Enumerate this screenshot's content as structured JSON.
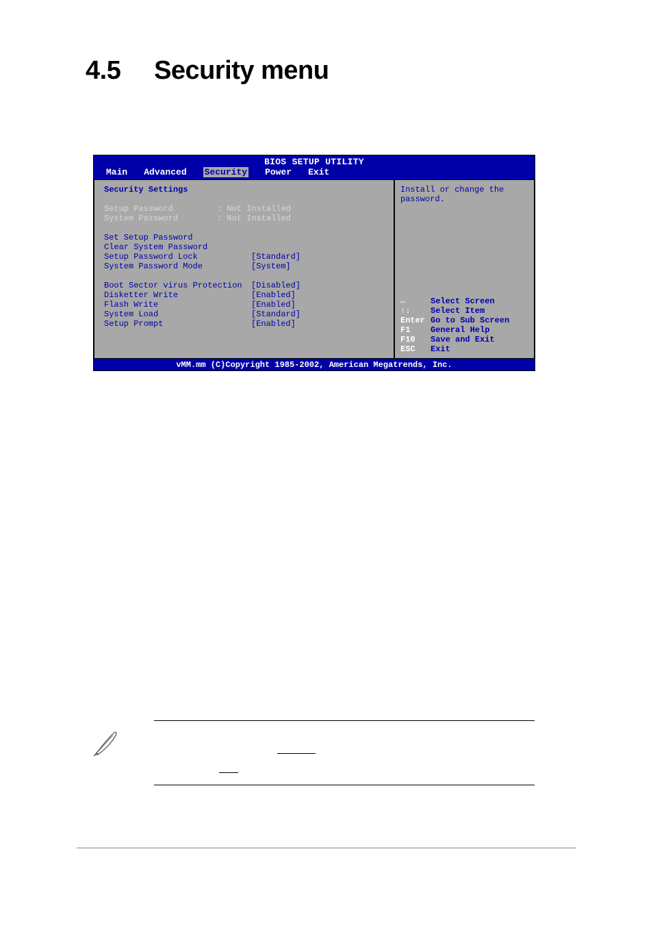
{
  "heading": {
    "num": "4.5",
    "title": "Security menu"
  },
  "bios": {
    "title": "BIOS SETUP UTILITY",
    "tabs": [
      "Main",
      "Advanced",
      "Security",
      "Power",
      "Exit"
    ],
    "selected_tab": "Security",
    "left": {
      "section_title": "Security Settings",
      "status_rows": [
        {
          "label": "Setup Password",
          "sep": ": ",
          "value": "Not Installed"
        },
        {
          "label": "System Password",
          "sep": ": ",
          "value": "Not Installed"
        }
      ],
      "action_rows": [
        {
          "label": "Set Setup Password",
          "value": ""
        },
        {
          "label": "Clear System Password",
          "value": ""
        },
        {
          "label": "Setup Password Lock",
          "value": "[Standard]"
        },
        {
          "label": "System Password Mode",
          "value": "[System]"
        }
      ],
      "option_rows": [
        {
          "label": "Boot Sector virus Protection",
          "value": "[Disabled]"
        },
        {
          "label": "Disketter Write",
          "value": "[Enabled]"
        },
        {
          "label": "Flash Write",
          "value": "[Enabled]"
        },
        {
          "label": "System Load",
          "value": "[Standard]"
        },
        {
          "label": "Setup Prompt",
          "value": "[Enabled]"
        }
      ]
    },
    "right": {
      "help_text": "Install or change the password.",
      "nav": [
        {
          "key": "↔",
          "text": "Select Screen"
        },
        {
          "key": "↑↓",
          "text": "Select Item"
        },
        {
          "key": "Enter",
          "text": "Go to Sub Screen"
        },
        {
          "key": "F1",
          "text": "General Help"
        },
        {
          "key": "F10",
          "text": "Save and Exit"
        },
        {
          "key": "ESC",
          "text": "Exit"
        }
      ]
    },
    "footer": "vMM.mm (C)Copyright 1985-2002, American Megatrends, Inc."
  }
}
